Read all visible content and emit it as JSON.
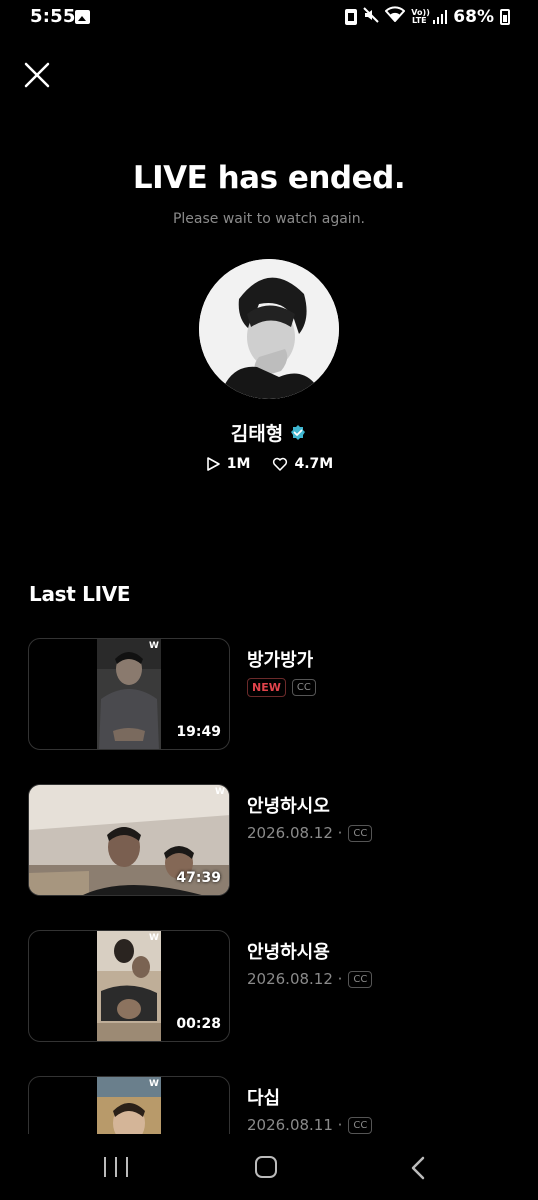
{
  "status_bar": {
    "time": "5:55",
    "volte": "Vo)) LTE",
    "battery_percent": "68%"
  },
  "main": {
    "headline": "LIVE has ended.",
    "subline": "Please wait to watch again.",
    "artist": {
      "name": "김태형",
      "plays": "1M",
      "likes": "4.7M"
    },
    "section_title": "Last LIVE"
  },
  "live_list": [
    {
      "title": "방가방가",
      "badge": "NEW",
      "date": "",
      "cc": "CC",
      "duration": "19:49"
    },
    {
      "title": "안녕하시오",
      "badge": "",
      "date": "2026.08.12 ·",
      "cc": "CC",
      "duration": "47:39"
    },
    {
      "title": "안녕하시용",
      "badge": "",
      "date": "2026.08.12 ·",
      "cc": "CC",
      "duration": "00:28"
    },
    {
      "title": "다십",
      "badge": "",
      "date": "2026.08.11 ·",
      "cc": "CC",
      "duration": ""
    }
  ],
  "thumb_logo": "W",
  "colors": {
    "background": "#000000",
    "secondary_text": "#8a8a8a",
    "new_badge": "#e0434b",
    "verified": "#3fb6d0"
  },
  "icons": [
    "close-icon",
    "verified-icon",
    "play-icon",
    "heart-icon",
    "recents-icon",
    "home-icon",
    "back-icon"
  ]
}
